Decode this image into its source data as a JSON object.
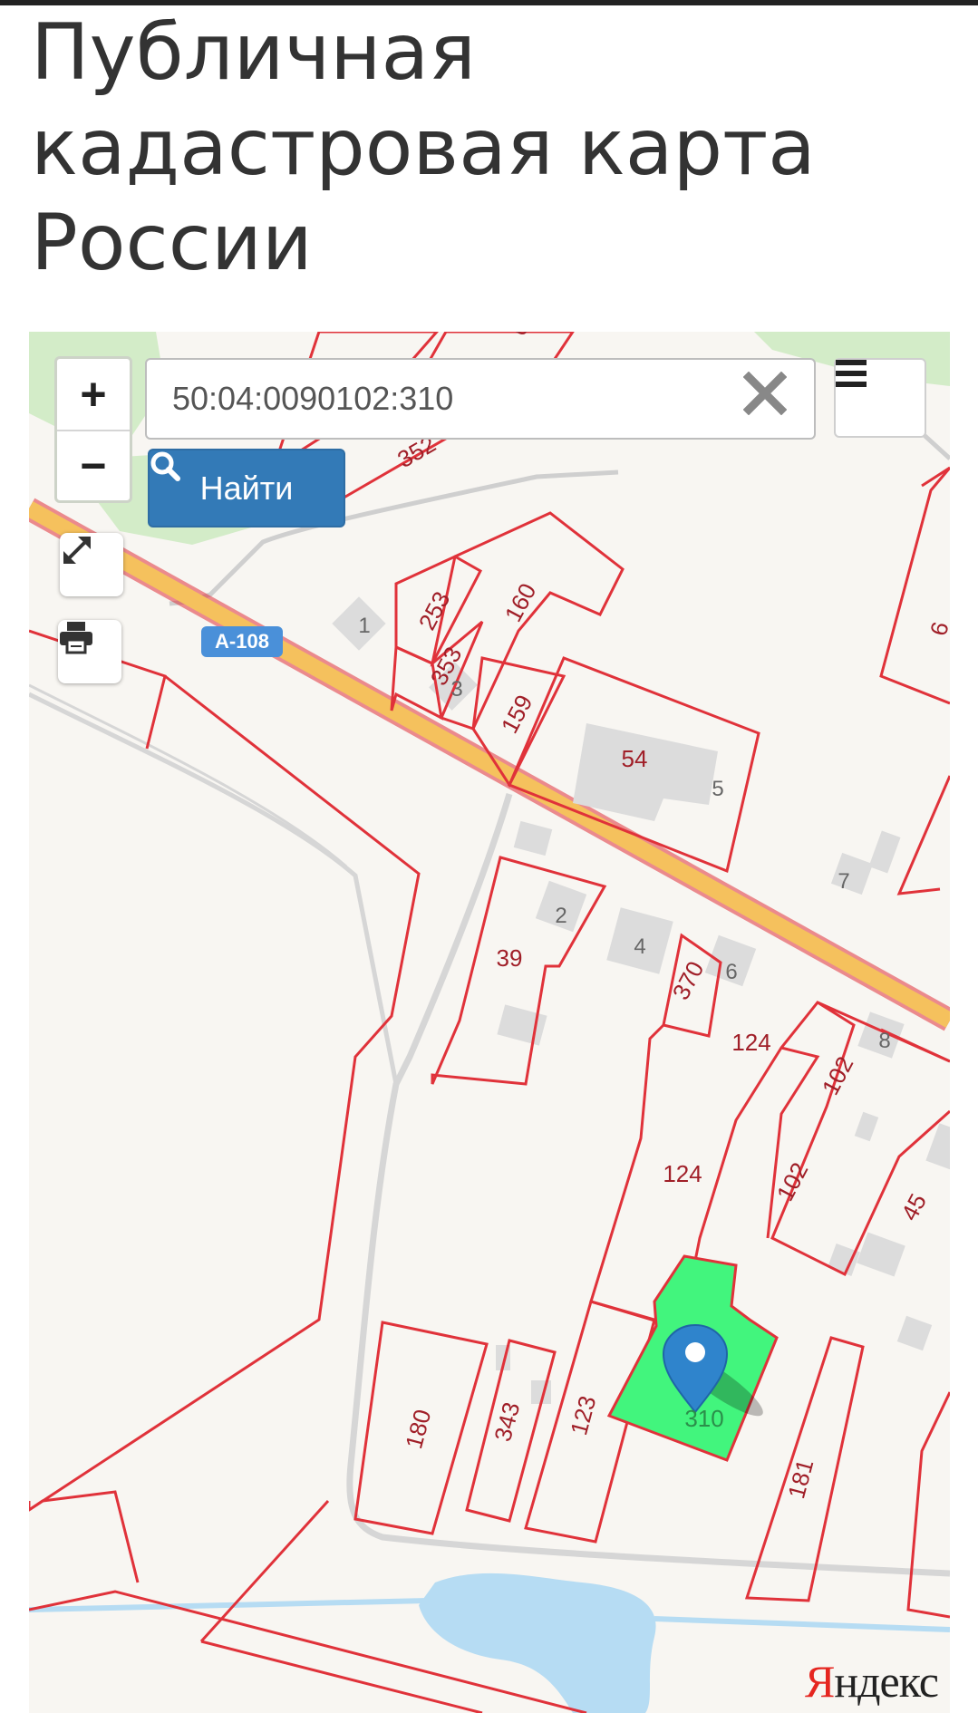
{
  "page": {
    "title": "Публичная кадастровая карта России"
  },
  "map_controls": {
    "zoom_in": "+",
    "zoom_out": "−",
    "search": {
      "value": "50:04:0090102:310"
    },
    "find_label": "Найти",
    "icons": {
      "clear": "close-icon",
      "menu": "menu-icon",
      "search": "search-icon",
      "fullscreen": "expand-icon",
      "print": "print-icon"
    }
  },
  "map": {
    "road_label": "А-108",
    "selected_parcel": "310",
    "parcel_labels": [
      "352",
      "253",
      "160",
      "353",
      "159",
      "54",
      "39",
      "370",
      "124",
      "124",
      "102",
      "102",
      "45",
      "180",
      "343",
      "123",
      "181"
    ],
    "building_numbers": [
      "1",
      "3",
      "5",
      "2",
      "4",
      "6",
      "7",
      "8"
    ],
    "partial_labels": [
      "6",
      "6"
    ],
    "attribution": {
      "first_letter": "Я",
      "rest": "ндекс"
    },
    "colors": {
      "background": "#f8f6f2",
      "parcel_border": "#e0323a",
      "selected_parcel_fill": "#42f57d",
      "road": "#f5c15d",
      "water": "#b6dcf3",
      "greenery": "#d3ecc8",
      "building": "#dcdcdc",
      "marker": "#2f84cc",
      "button_primary": "#337ab7"
    }
  }
}
